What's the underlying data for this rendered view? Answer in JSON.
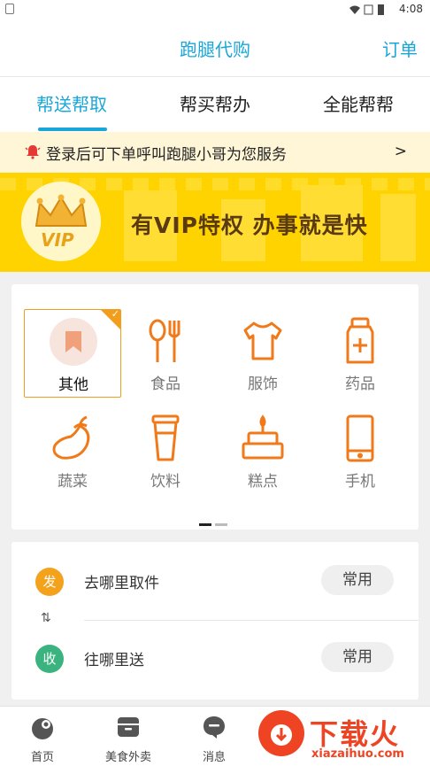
{
  "status_bar": {
    "time": "4:08",
    "icons": [
      "wifi-icon",
      "signal-icon",
      "battery-icon"
    ]
  },
  "header": {
    "title": "跑腿代购",
    "orders_link": "订单"
  },
  "tabs": [
    {
      "label": "帮送帮取",
      "active": true
    },
    {
      "label": "帮买帮办",
      "active": false
    },
    {
      "label": "全能帮帮",
      "active": false
    }
  ],
  "notice": {
    "text": "登录后可下单呼叫跑腿小哥为您服务",
    "arrow": ">"
  },
  "banner": {
    "vip_badge": "VIP",
    "slogan": "有VIP特权  办事就是快"
  },
  "categories": [
    {
      "label": "其他",
      "icon": "bookmark-icon",
      "selected": true
    },
    {
      "label": "食品",
      "icon": "spoon-fork-icon",
      "selected": false
    },
    {
      "label": "服饰",
      "icon": "tshirt-icon",
      "selected": false
    },
    {
      "label": "药品",
      "icon": "medicine-bottle-icon",
      "selected": false
    },
    {
      "label": "蔬菜",
      "icon": "eggplant-icon",
      "selected": false
    },
    {
      "label": "饮料",
      "icon": "drink-cup-icon",
      "selected": false
    },
    {
      "label": "糕点",
      "icon": "cake-icon",
      "selected": false
    },
    {
      "label": "手机",
      "icon": "phone-icon",
      "selected": false
    }
  ],
  "pager": {
    "pages": 2,
    "current": 1
  },
  "addresses": {
    "pickup": {
      "badge": "发",
      "text": "去哪里取件",
      "chip": "常用"
    },
    "dropoff": {
      "badge": "收",
      "text": "往哪里送",
      "chip": "常用"
    }
  },
  "bottom_nav": [
    {
      "label": "首页",
      "icon": "home-icon"
    },
    {
      "label": "美食外卖",
      "icon": "takeout-box-icon"
    },
    {
      "label": "消息",
      "icon": "message-icon"
    }
  ],
  "watermark": {
    "brand": "下载火",
    "url": "xiazaihuo.com"
  },
  "colors": {
    "accent": "#1aa7d8",
    "orange": "#f29d1b",
    "banner": "#ffd300",
    "pickup_badge": "#f4a11c",
    "dropoff_badge": "#3bb37f"
  }
}
